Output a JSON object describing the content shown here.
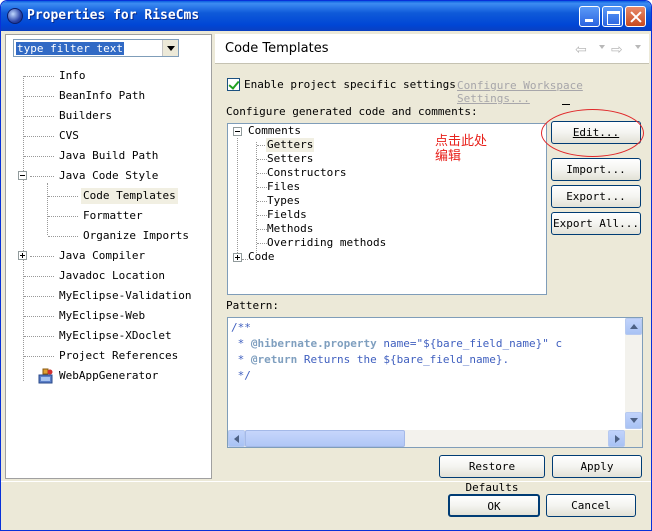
{
  "window": {
    "title": "Properties for RiseCms"
  },
  "filter": {
    "text": "type filter text"
  },
  "nav_tree": [
    {
      "label": "Info"
    },
    {
      "label": "BeanInfo Path"
    },
    {
      "label": "Builders"
    },
    {
      "label": "CVS"
    },
    {
      "label": "Java Build Path"
    },
    {
      "label": "Java Code Style",
      "expanded": true
    },
    {
      "label": "Code Templates",
      "selected": true
    },
    {
      "label": "Formatter"
    },
    {
      "label": "Organize Imports"
    },
    {
      "label": "Java Compiler",
      "expanded": false
    },
    {
      "label": "Javadoc Location"
    },
    {
      "label": "MyEclipse-Validation"
    },
    {
      "label": "MyEclipse-Web"
    },
    {
      "label": "MyEclipse-XDoclet"
    },
    {
      "label": "Project References"
    },
    {
      "label": "WebAppGenerator"
    }
  ],
  "page": {
    "title": "Code Templates",
    "enable_label": "Enable project specific settings",
    "configure_link": "Configure Workspace Settings...",
    "configure_label": "Configure generated code and comments:",
    "pattern_label": "Pattern:"
  },
  "code_tree": {
    "comments": "Comments",
    "children": [
      "Getters",
      "Setters",
      "Constructors",
      "Files",
      "Types",
      "Fields",
      "Methods",
      "Overriding methods"
    ],
    "code": "Code"
  },
  "side_buttons": {
    "edit": "Edit...",
    "import": "Import...",
    "export": "Export...",
    "export_all": "Export All..."
  },
  "annotation": {
    "line1": "点击此处",
    "line2": "编辑"
  },
  "pattern": {
    "line1": "/**",
    "line2_prefix": " * ",
    "line2_tag": "@hibernate.property",
    "line2_rest": " name=\"${bare_field_name}\" c",
    "line3_prefix": " * ",
    "line3_tag": "@return",
    "line3_rest": " Returns the ${bare_field_name}.",
    "line4": " */"
  },
  "page_buttons": {
    "restore": "Restore Defaults",
    "apply": "Apply"
  },
  "dialog_buttons": {
    "ok": "OK",
    "cancel": "Cancel"
  },
  "colors": {
    "title_bar": "#0054e3",
    "annotation": "#e8221c",
    "comment_text": "#3f5fbf",
    "javadoc_tag": "#7f9fbf"
  }
}
